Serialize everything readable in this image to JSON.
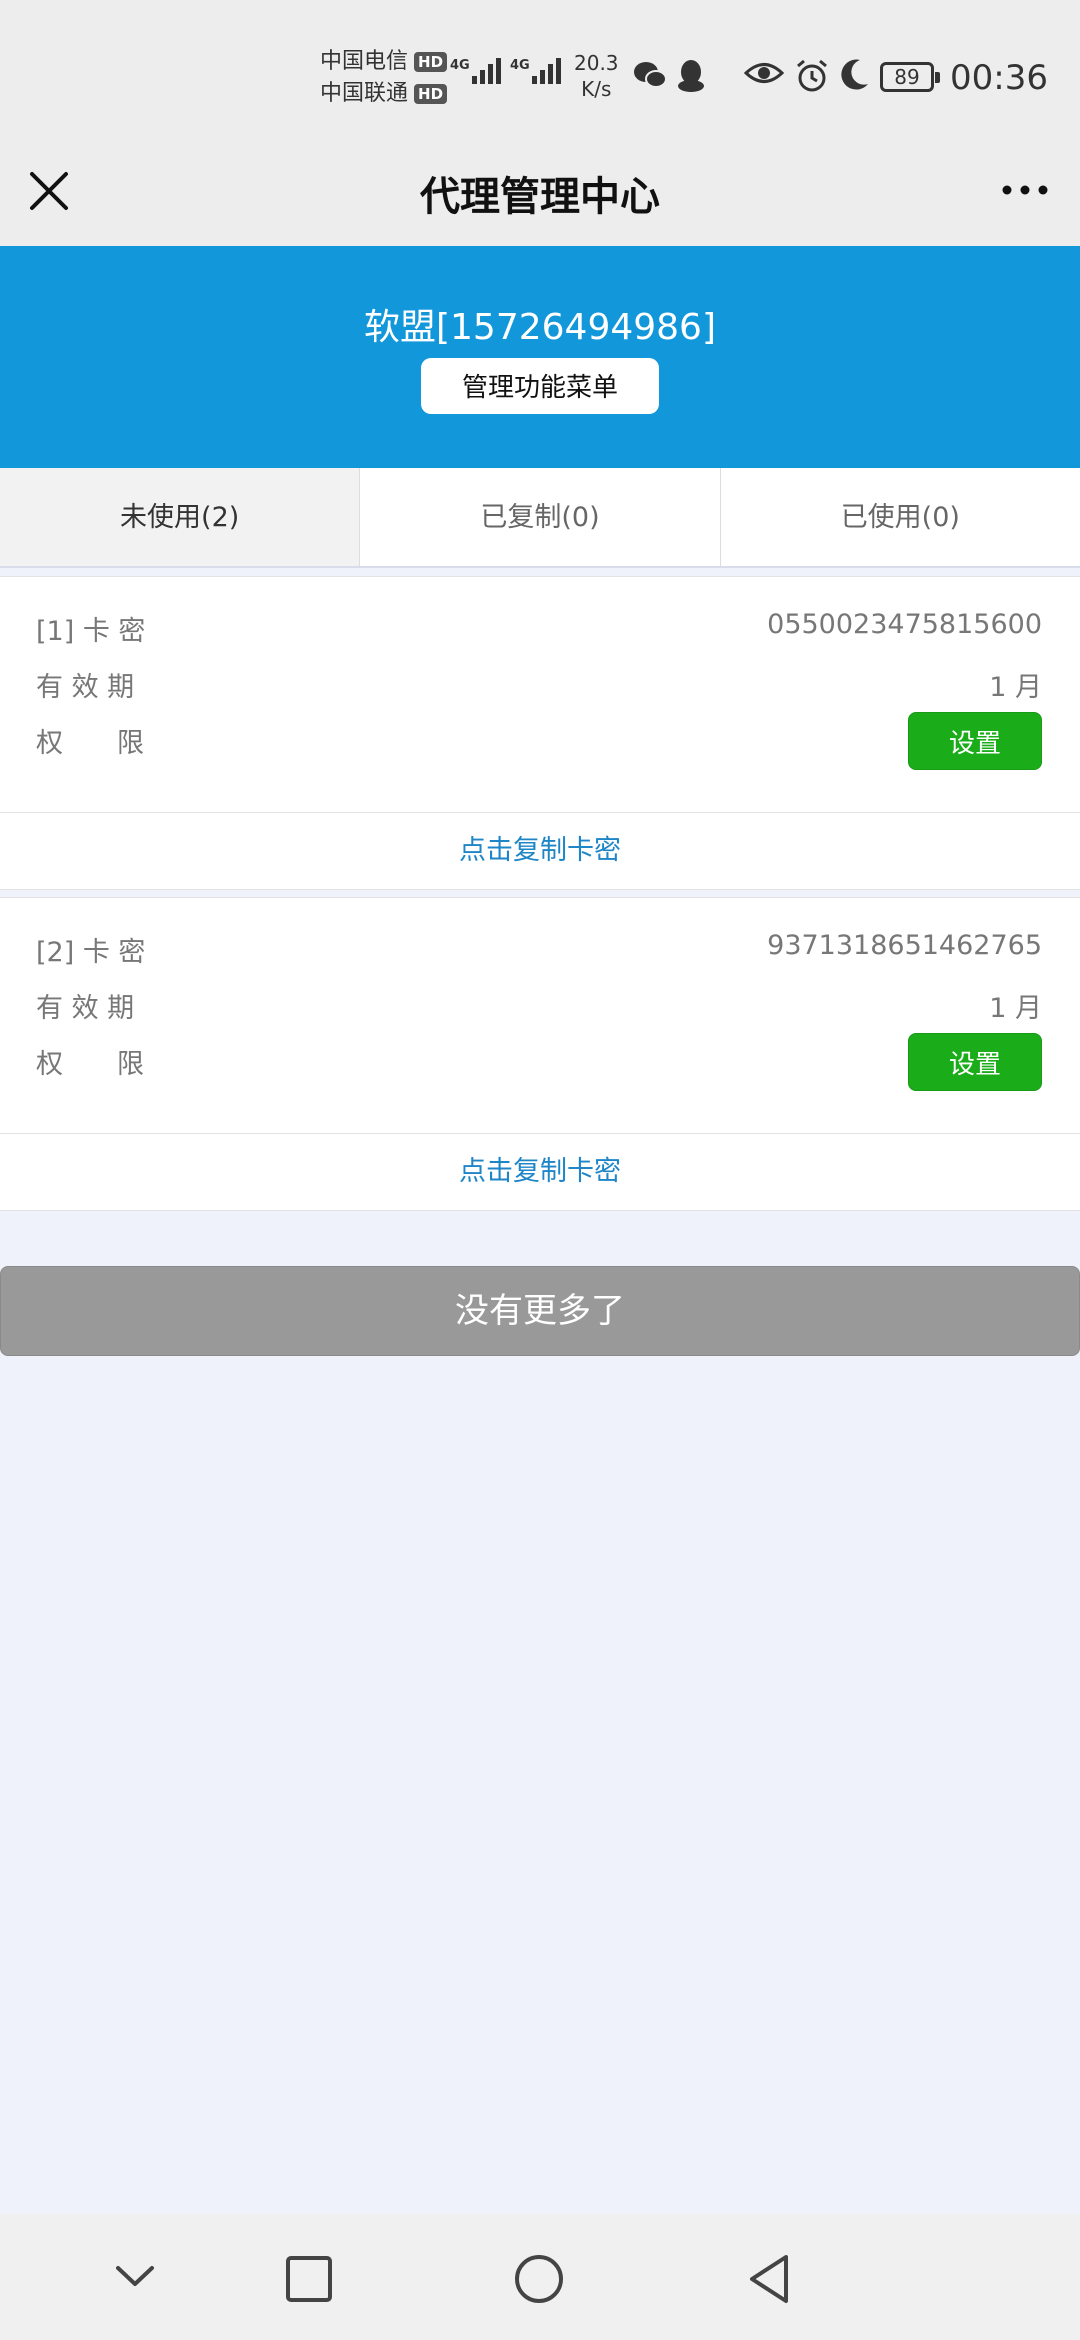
{
  "status_bar": {
    "carrier1": "中国电信",
    "carrier2": "中国联通",
    "hd": "HD",
    "net_type": "4G",
    "speed_value": "20.3",
    "speed_unit": "K/s",
    "battery": "89",
    "time": "00:36"
  },
  "nav": {
    "title": "代理管理中心"
  },
  "header": {
    "account": "软盟[15726494986]",
    "menu_button": "管理功能菜单"
  },
  "tabs": [
    {
      "label": "未使用(2)",
      "active": true
    },
    {
      "label": "已复制(0)",
      "active": false
    },
    {
      "label": "已使用(0)",
      "active": false
    }
  ],
  "labels": {
    "validity": "有 效 期",
    "permission": "权　　限"
  },
  "cards": [
    {
      "key_label": "[1]  卡  密",
      "key": "0550023475815600",
      "validity": "1 月",
      "set_button": "设置",
      "copy_link": "点击复制卡密"
    },
    {
      "key_label": "[2]  卡  密",
      "key": "9371318651462765",
      "validity": "1 月",
      "set_button": "设置",
      "copy_link": "点击复制卡密"
    }
  ],
  "footer": {
    "no_more": "没有更多了"
  },
  "colors": {
    "header_blue": "#1297db",
    "button_green": "#1aad19",
    "link_blue": "#1e86c7"
  }
}
